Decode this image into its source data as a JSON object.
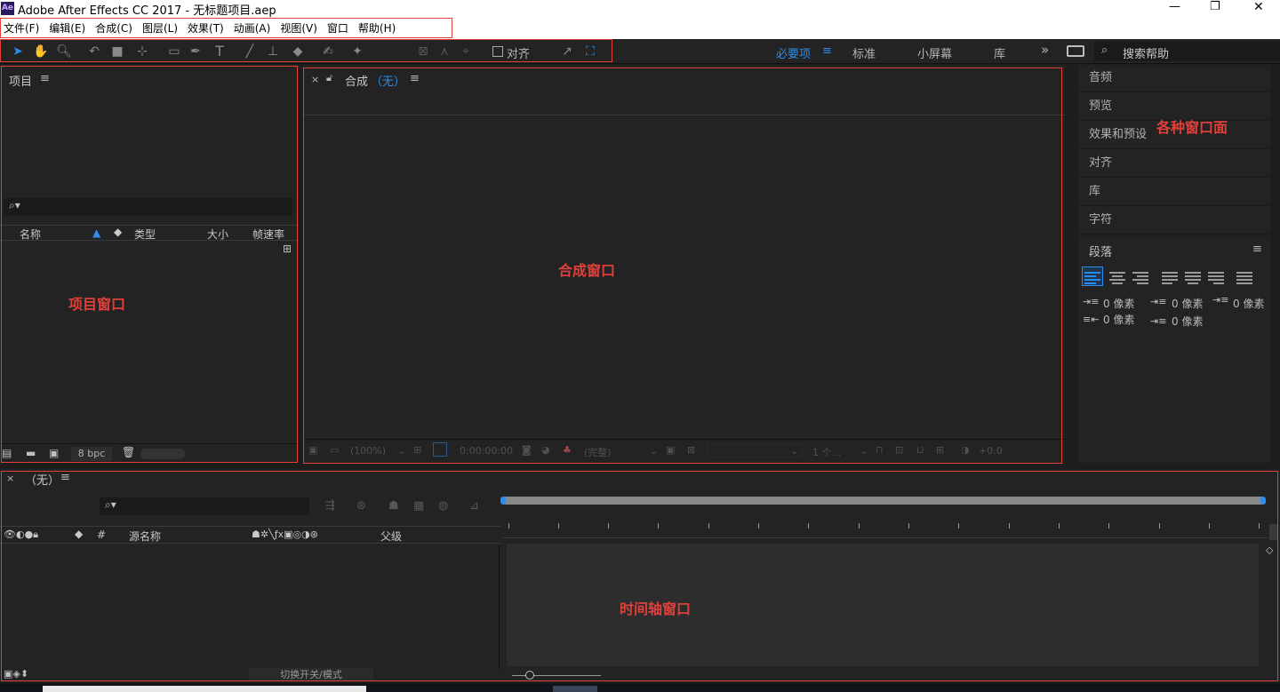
{
  "window": {
    "app_icon": "Ae",
    "title": "Adobe After Effects CC 2017 - 无标题项目.aep",
    "min": "—",
    "restore": "❐",
    "close": "✕"
  },
  "menu": [
    "文件(F)",
    "编辑(E)",
    "合成(C)",
    "图层(L)",
    "效果(T)",
    "动画(A)",
    "视图(V)",
    "窗口",
    "帮助(H)"
  ],
  "toolbar": {
    "snap_label": "对齐",
    "workspaces": [
      "必要项",
      "标准",
      "小屏幕",
      "库"
    ],
    "active_workspace": "必要项",
    "more": "»",
    "search_placeholder": "搜索帮助"
  },
  "project": {
    "title": "项目",
    "menu_icon": "≡",
    "search_glyph": "⌕▾",
    "columns": [
      "名称",
      "类型",
      "大小",
      "帧速率"
    ],
    "bpc": "8 bpc",
    "annotation": "项目窗口"
  },
  "composition": {
    "close": "×",
    "title": "合成",
    "name": "（无）",
    "menu_icon": "≡",
    "annotation": "合成窗口",
    "footer": {
      "zoom": "(100%)",
      "timecode": "0:00:00:00",
      "resolution": "(完整)",
      "views": "1 个...",
      "exposure": "+0.0"
    }
  },
  "right_panels": {
    "items": [
      "音频",
      "预览",
      "效果和预设",
      "对齐",
      "库",
      "字符"
    ],
    "annotation": "各种窗口面",
    "paragraph": {
      "title": "段落",
      "menu_icon": "≡",
      "values": [
        "0 像素",
        "0 像素",
        "0 像素",
        "0 像素",
        "0 像素"
      ]
    }
  },
  "timeline": {
    "close": "×",
    "title": "（无）",
    "menu_icon": "≡",
    "search_glyph": "⌕▾",
    "col_number": "#",
    "col_source": "源名称",
    "col_parent": "父级",
    "toggle_label": "切换开关/模式",
    "annotation": "时间轴窗口"
  },
  "colors": {
    "accent": "#2d8ceb",
    "annotation": "#e0403a",
    "panel_bg": "#232323"
  }
}
